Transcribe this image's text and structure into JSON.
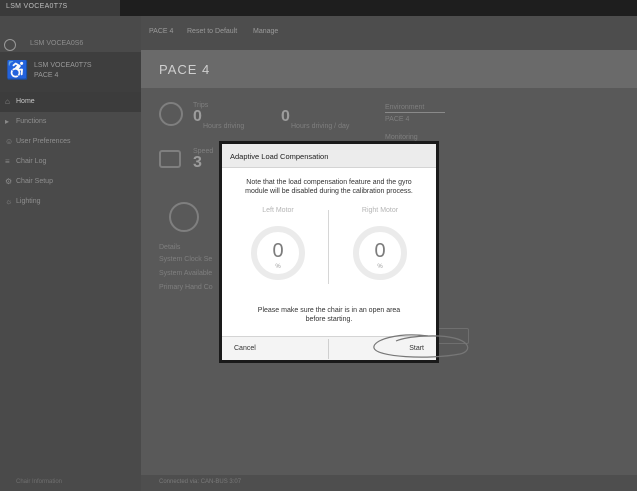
{
  "window": {
    "tab_label": "LSM VOCEA0T7S"
  },
  "sidebar": {
    "user": "LSM VOCEA0S6",
    "chair_lines": [
      "LSM VOCEA0T7S",
      "PACE 4"
    ],
    "items": [
      {
        "label": "Home",
        "icon": "home-icon"
      },
      {
        "label": "Functions",
        "icon": "functions-icon"
      },
      {
        "label": "User Preferences",
        "icon": "user-prefs-icon"
      },
      {
        "label": "Chair Log",
        "icon": "log-icon"
      },
      {
        "label": "Chair Setup",
        "icon": "setup-icon"
      },
      {
        "label": "Lighting",
        "icon": "lighting-icon"
      }
    ],
    "bottom": "Chair Information"
  },
  "toolbar": {
    "items": [
      "PACE 4",
      "Reset to Default",
      "Manage"
    ]
  },
  "header": {
    "title": "PACE 4"
  },
  "background": {
    "stat1_label": "Trips",
    "stat1_value": "0",
    "stat1_sub": "Hours driving",
    "stat2_value": "0",
    "stat2_sub": "Hours driving / day",
    "stat3_label": "Speed",
    "stat3_value": "3",
    "side_label1": "Environment",
    "side_value1": "PACE 4",
    "side_label2": "Monitoring",
    "list_lines": [
      "System Clock Se",
      "System Available",
      "Primary Hand Co"
    ],
    "details": "Details",
    "footer_left": "Connected via: CAN-BUS 3:07"
  },
  "modal": {
    "title": "Adaptive Load Compensation",
    "message": "Note that the load compensation feature and the gyro module will be disabled during the calibration process.",
    "left_motor": {
      "label": "Left Motor",
      "value": "0",
      "unit": "%"
    },
    "right_motor": {
      "label": "Right Motor",
      "value": "0",
      "unit": "%"
    },
    "note": "Please make sure the chair is in an open area before starting.",
    "cancel_label": "Cancel",
    "start_label": "Start"
  },
  "colors": {
    "overlay": "#2b2b2b",
    "modal_bg": "#ffffff",
    "gauge_ring": "#ebebeb"
  }
}
